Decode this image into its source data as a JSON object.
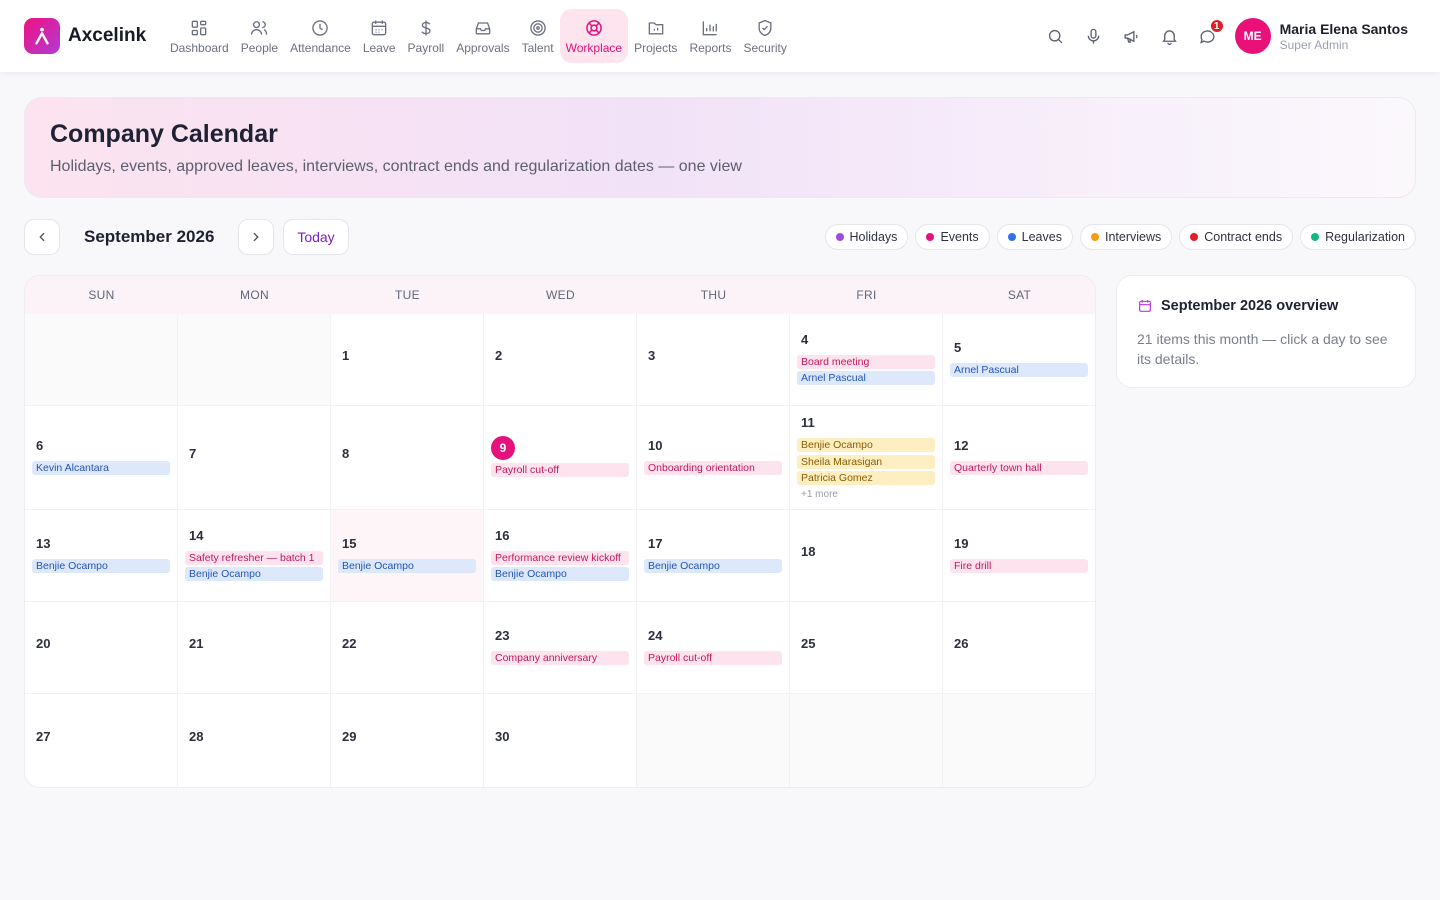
{
  "app": {
    "name": "Axcelink"
  },
  "nav": [
    {
      "label": "Dashboard",
      "icon": "dashboard-icon"
    },
    {
      "label": "People",
      "icon": "people-icon"
    },
    {
      "label": "Attendance",
      "icon": "clock-icon"
    },
    {
      "label": "Leave",
      "icon": "calendar-icon"
    },
    {
      "label": "Payroll",
      "icon": "dollar-icon"
    },
    {
      "label": "Approvals",
      "icon": "inbox-icon"
    },
    {
      "label": "Talent",
      "icon": "target-icon"
    },
    {
      "label": "Workplace",
      "icon": "lifebuoy-icon",
      "active": true
    },
    {
      "label": "Projects",
      "icon": "folder-icon"
    },
    {
      "label": "Reports",
      "icon": "bar-chart-icon"
    },
    {
      "label": "Security",
      "icon": "shield-icon"
    }
  ],
  "user": {
    "initials": "ME",
    "name": "Maria Elena Santos",
    "role": "Super Admin",
    "notification_count": "1"
  },
  "hero": {
    "title": "Company Calendar",
    "subtitle": "Holidays, events, approved leaves, interviews, contract ends and regularization dates — one view"
  },
  "toolbar": {
    "month": "September 2026",
    "today_label": "Today"
  },
  "legend": [
    {
      "label": "Holidays",
      "color": "#9b4dde"
    },
    {
      "label": "Events",
      "color": "#e3127e"
    },
    {
      "label": "Leaves",
      "color": "#2f74e8"
    },
    {
      "label": "Interviews",
      "color": "#f59e0b"
    },
    {
      "label": "Contract ends",
      "color": "#e11d2a"
    },
    {
      "label": "Regularization",
      "color": "#10b981"
    }
  ],
  "calendar": {
    "weekdays": [
      "SUN",
      "MON",
      "TUE",
      "WED",
      "THU",
      "FRI",
      "SAT"
    ],
    "today": "9",
    "weeks": [
      [
        {
          "day": "",
          "events": []
        },
        {
          "day": "",
          "events": []
        },
        {
          "day": "1",
          "events": []
        },
        {
          "day": "2",
          "events": []
        },
        {
          "day": "3",
          "events": []
        },
        {
          "day": "4",
          "events": [
            {
              "label": "Board meeting",
              "type": "event"
            },
            {
              "label": "Arnel Pascual",
              "type": "leave"
            }
          ]
        },
        {
          "day": "5",
          "events": [
            {
              "label": "Arnel Pascual",
              "type": "leave"
            }
          ]
        }
      ],
      [
        {
          "day": "6",
          "events": [
            {
              "label": "Kevin Alcantara",
              "type": "leave"
            }
          ]
        },
        {
          "day": "7",
          "events": []
        },
        {
          "day": "8",
          "events": []
        },
        {
          "day": "9",
          "events": [
            {
              "label": "Payroll cut-off",
              "type": "event"
            }
          ]
        },
        {
          "day": "10",
          "events": [
            {
              "label": "Onboarding orientation",
              "type": "event"
            }
          ]
        },
        {
          "day": "11",
          "events": [
            {
              "label": "Benjie Ocampo",
              "type": "interview"
            },
            {
              "label": "Sheila Marasigan",
              "type": "interview"
            },
            {
              "label": "Patricia Gomez",
              "type": "interview"
            }
          ],
          "more": "+1 more"
        },
        {
          "day": "12",
          "events": [
            {
              "label": "Quarterly town hall",
              "type": "event"
            }
          ]
        }
      ],
      [
        {
          "day": "13",
          "events": [
            {
              "label": "Benjie Ocampo",
              "type": "leave"
            }
          ]
        },
        {
          "day": "14",
          "events": [
            {
              "label": "Safety refresher — batch 1",
              "type": "event"
            },
            {
              "label": "Benjie Ocampo",
              "type": "leave"
            }
          ]
        },
        {
          "day": "15",
          "events": [
            {
              "label": "Benjie Ocampo",
              "type": "leave"
            }
          ],
          "highlight": true
        },
        {
          "day": "16",
          "events": [
            {
              "label": "Performance review kickoff",
              "type": "event"
            },
            {
              "label": "Benjie Ocampo",
              "type": "leave"
            }
          ]
        },
        {
          "day": "17",
          "events": [
            {
              "label": "Benjie Ocampo",
              "type": "leave"
            }
          ]
        },
        {
          "day": "18",
          "events": []
        },
        {
          "day": "19",
          "events": [
            {
              "label": "Fire drill",
              "type": "event"
            }
          ]
        }
      ],
      [
        {
          "day": "20",
          "events": []
        },
        {
          "day": "21",
          "events": []
        },
        {
          "day": "22",
          "events": []
        },
        {
          "day": "23",
          "events": [
            {
              "label": "Company anniversary",
              "type": "event"
            }
          ]
        },
        {
          "day": "24",
          "events": [
            {
              "label": "Payroll cut-off",
              "type": "event"
            }
          ]
        },
        {
          "day": "25",
          "events": []
        },
        {
          "day": "26",
          "events": []
        }
      ],
      [
        {
          "day": "27",
          "events": []
        },
        {
          "day": "28",
          "events": []
        },
        {
          "day": "29",
          "events": []
        },
        {
          "day": "30",
          "events": []
        },
        {
          "day": "",
          "events": []
        },
        {
          "day": "",
          "events": []
        },
        {
          "day": "",
          "events": []
        }
      ]
    ]
  },
  "overview": {
    "title": "September 2026 overview",
    "text": "21 items this month — click a day to see its details."
  }
}
